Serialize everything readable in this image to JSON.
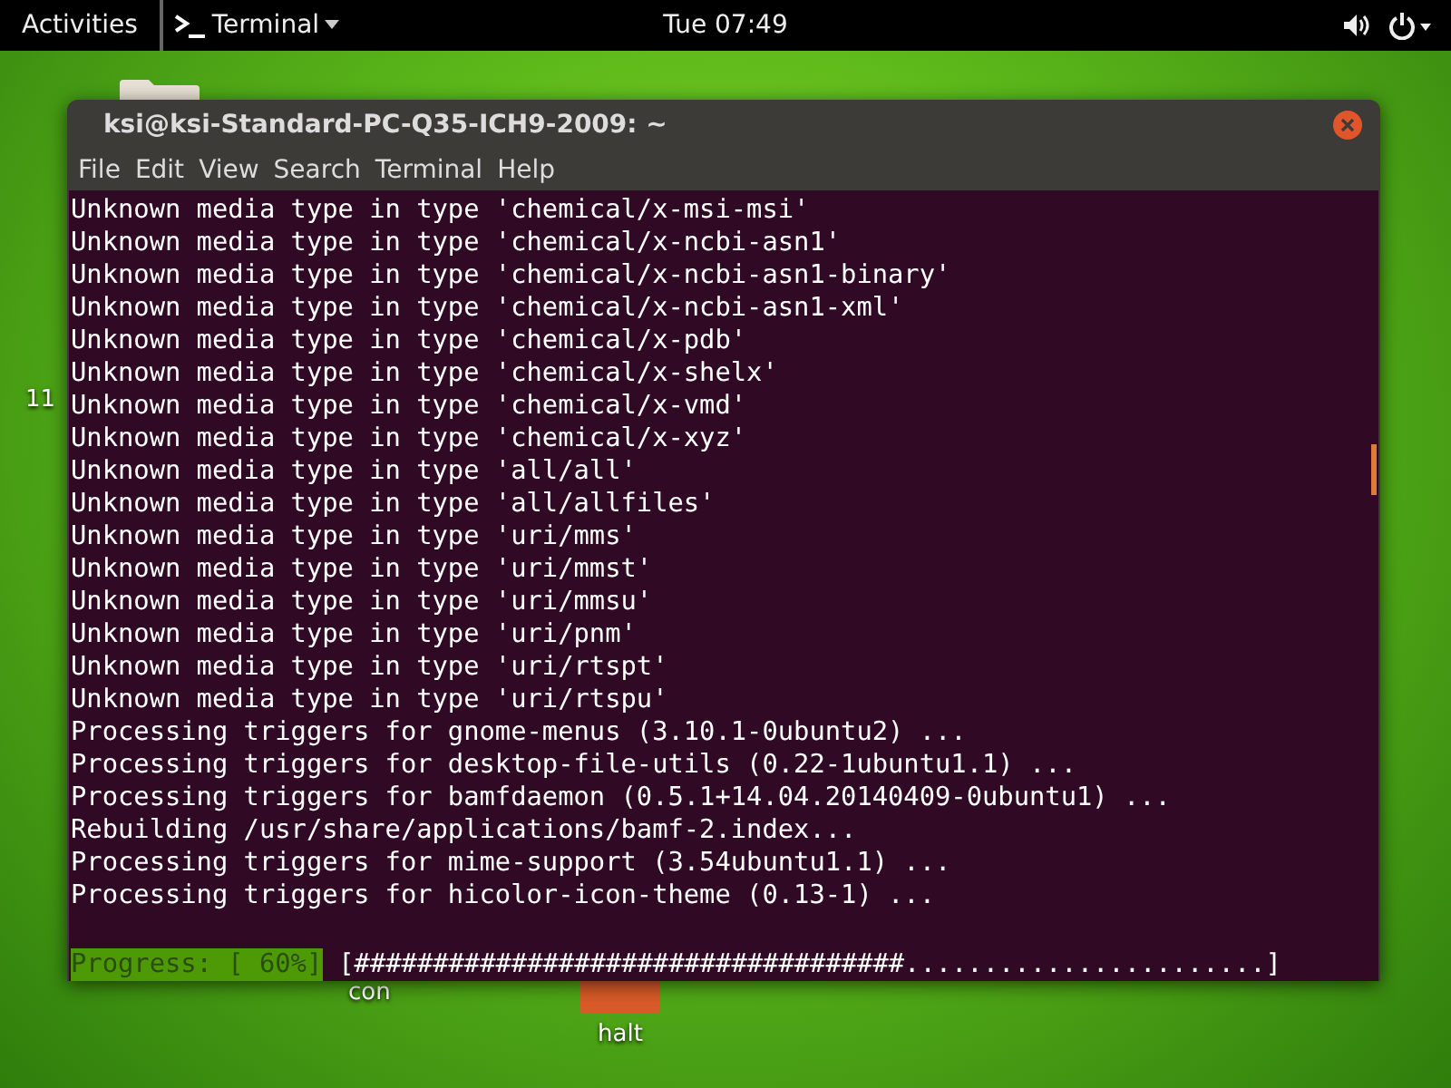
{
  "top_bar": {
    "activities": "Activities",
    "app_menu": "Terminal",
    "clock": "Tue 07:49"
  },
  "desktop_icons": [
    {
      "kind": "folder"
    },
    {
      "kind": "label-only",
      "label": "11"
    },
    {
      "kind": "label-only",
      "label": "con"
    },
    {
      "kind": "launcher",
      "label": "halt"
    }
  ],
  "window": {
    "title": "ksi@ksi-Standard-PC-Q35-ICH9-2009: ~",
    "menu": [
      "File",
      "Edit",
      "View",
      "Search",
      "Terminal",
      "Help"
    ],
    "lines": [
      "Unknown media type in type 'chemical/x-msi-msi'",
      "Unknown media type in type 'chemical/x-ncbi-asn1'",
      "Unknown media type in type 'chemical/x-ncbi-asn1-binary'",
      "Unknown media type in type 'chemical/x-ncbi-asn1-xml'",
      "Unknown media type in type 'chemical/x-pdb'",
      "Unknown media type in type 'chemical/x-shelx'",
      "Unknown media type in type 'chemical/x-vmd'",
      "Unknown media type in type 'chemical/x-xyz'",
      "Unknown media type in type 'all/all'",
      "Unknown media type in type 'all/allfiles'",
      "Unknown media type in type 'uri/mms'",
      "Unknown media type in type 'uri/mmst'",
      "Unknown media type in type 'uri/mmsu'",
      "Unknown media type in type 'uri/pnm'",
      "Unknown media type in type 'uri/rtspt'",
      "Unknown media type in type 'uri/rtspu'",
      "Processing triggers for gnome-menus (3.10.1-0ubuntu2) ...",
      "Processing triggers for desktop-file-utils (0.22-1ubuntu1.1) ...",
      "Processing triggers for bamfdaemon (0.5.1+14.04.20140409-0ubuntu1) ...",
      "Rebuilding /usr/share/applications/bamf-2.index...",
      "Processing triggers for mime-support (3.54ubuntu1.1) ...",
      "Processing triggers for hicolor-icon-theme (0.13-1) ..."
    ],
    "progress": {
      "label": "Progress: [ 60%]",
      "bar": "[###################################.......................]"
    }
  }
}
